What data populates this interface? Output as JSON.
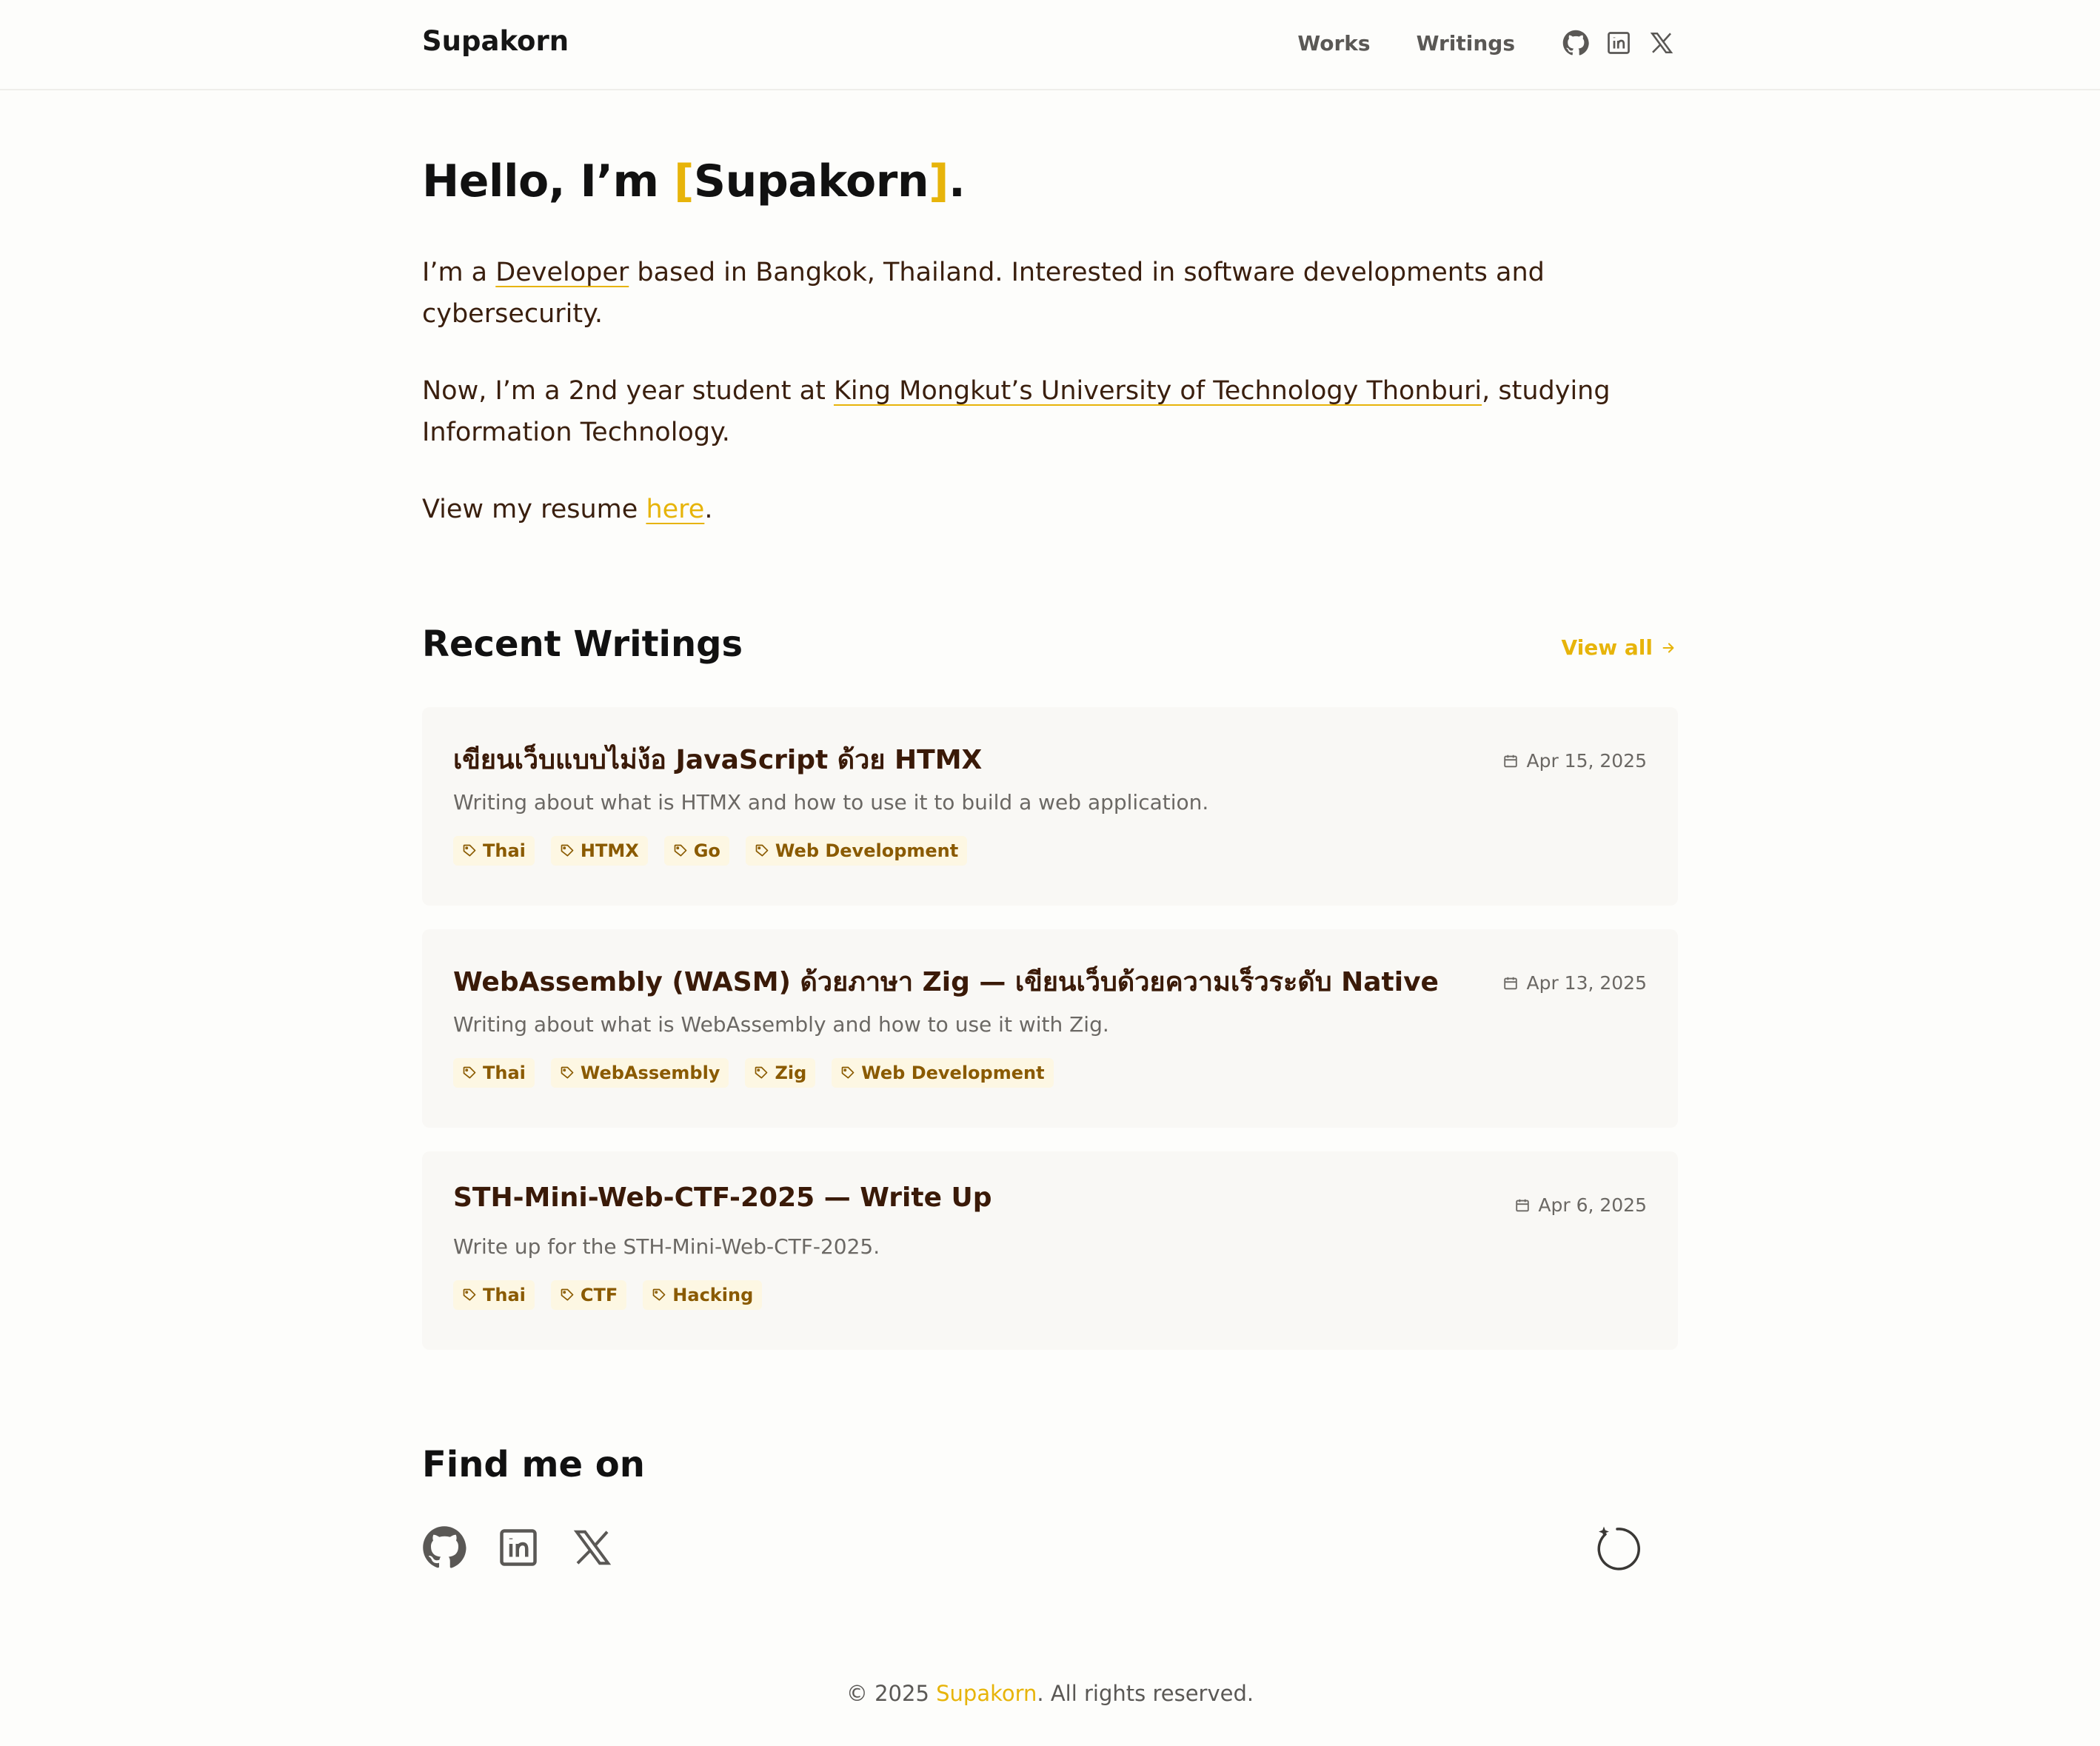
{
  "header": {
    "brand": "Supakorn",
    "nav": [
      {
        "label": "Works"
      },
      {
        "label": "Writings"
      }
    ],
    "icons": [
      "github-icon",
      "linkedin-icon",
      "x-icon"
    ]
  },
  "intro": {
    "greeting_prefix": "Hello, I’m ",
    "bracket_open": "[",
    "name": "Supakorn",
    "bracket_close": "]",
    "greeting_suffix": ".",
    "p1_prefix": "I’m a ",
    "p1_link": "Developer",
    "p1_suffix": " based in Bangkok, Thailand. Interested in software developments and cybersecurity.",
    "p2_prefix": "Now, I’m a 2nd year student at ",
    "p2_link": "King Mongkut’s University of Technology Thonburi",
    "p2_suffix": ", studying Information Technology.",
    "p3_prefix": "View my resume ",
    "p3_link": "here",
    "p3_suffix": "."
  },
  "recent": {
    "title": "Recent Writings",
    "view_all": "View all",
    "posts": [
      {
        "title": "เขียนเว็บแบบไม่ง้อ JavaScript ด้วย HTMX",
        "date": "Apr 15, 2025",
        "description": "Writing about what is HTMX and how to use it to build a web application.",
        "tags": [
          "Thai",
          "HTMX",
          "Go",
          "Web Development"
        ]
      },
      {
        "title": "WebAssembly (WASM) ด้วยภาษา Zig — เขียนเว็บด้วยความเร็วระดับ Native",
        "date": "Apr 13, 2025",
        "description": "Writing about what is WebAssembly and how to use it with Zig.",
        "tags": [
          "Thai",
          "WebAssembly",
          "Zig",
          "Web Development"
        ]
      },
      {
        "title": "STH-Mini-Web-CTF-2025 — Write Up",
        "date": "Apr 6, 2025",
        "description": "Write up for the STH-Mini-Web-CTF-2025.",
        "tags": [
          "Thai",
          "CTF",
          "Hacking"
        ]
      }
    ]
  },
  "find": {
    "title": "Find me on",
    "icons": [
      "github-icon",
      "linkedin-icon",
      "x-icon"
    ]
  },
  "footer": {
    "prefix": "© 2025 ",
    "name": "Supakorn",
    "suffix": ". All rights reserved."
  },
  "colors": {
    "accent": "#e7b40a",
    "text": "#3a1f0e",
    "background": "#fdfdfb",
    "card": "#f9f8f5",
    "tag_bg": "#fdf7e3"
  }
}
